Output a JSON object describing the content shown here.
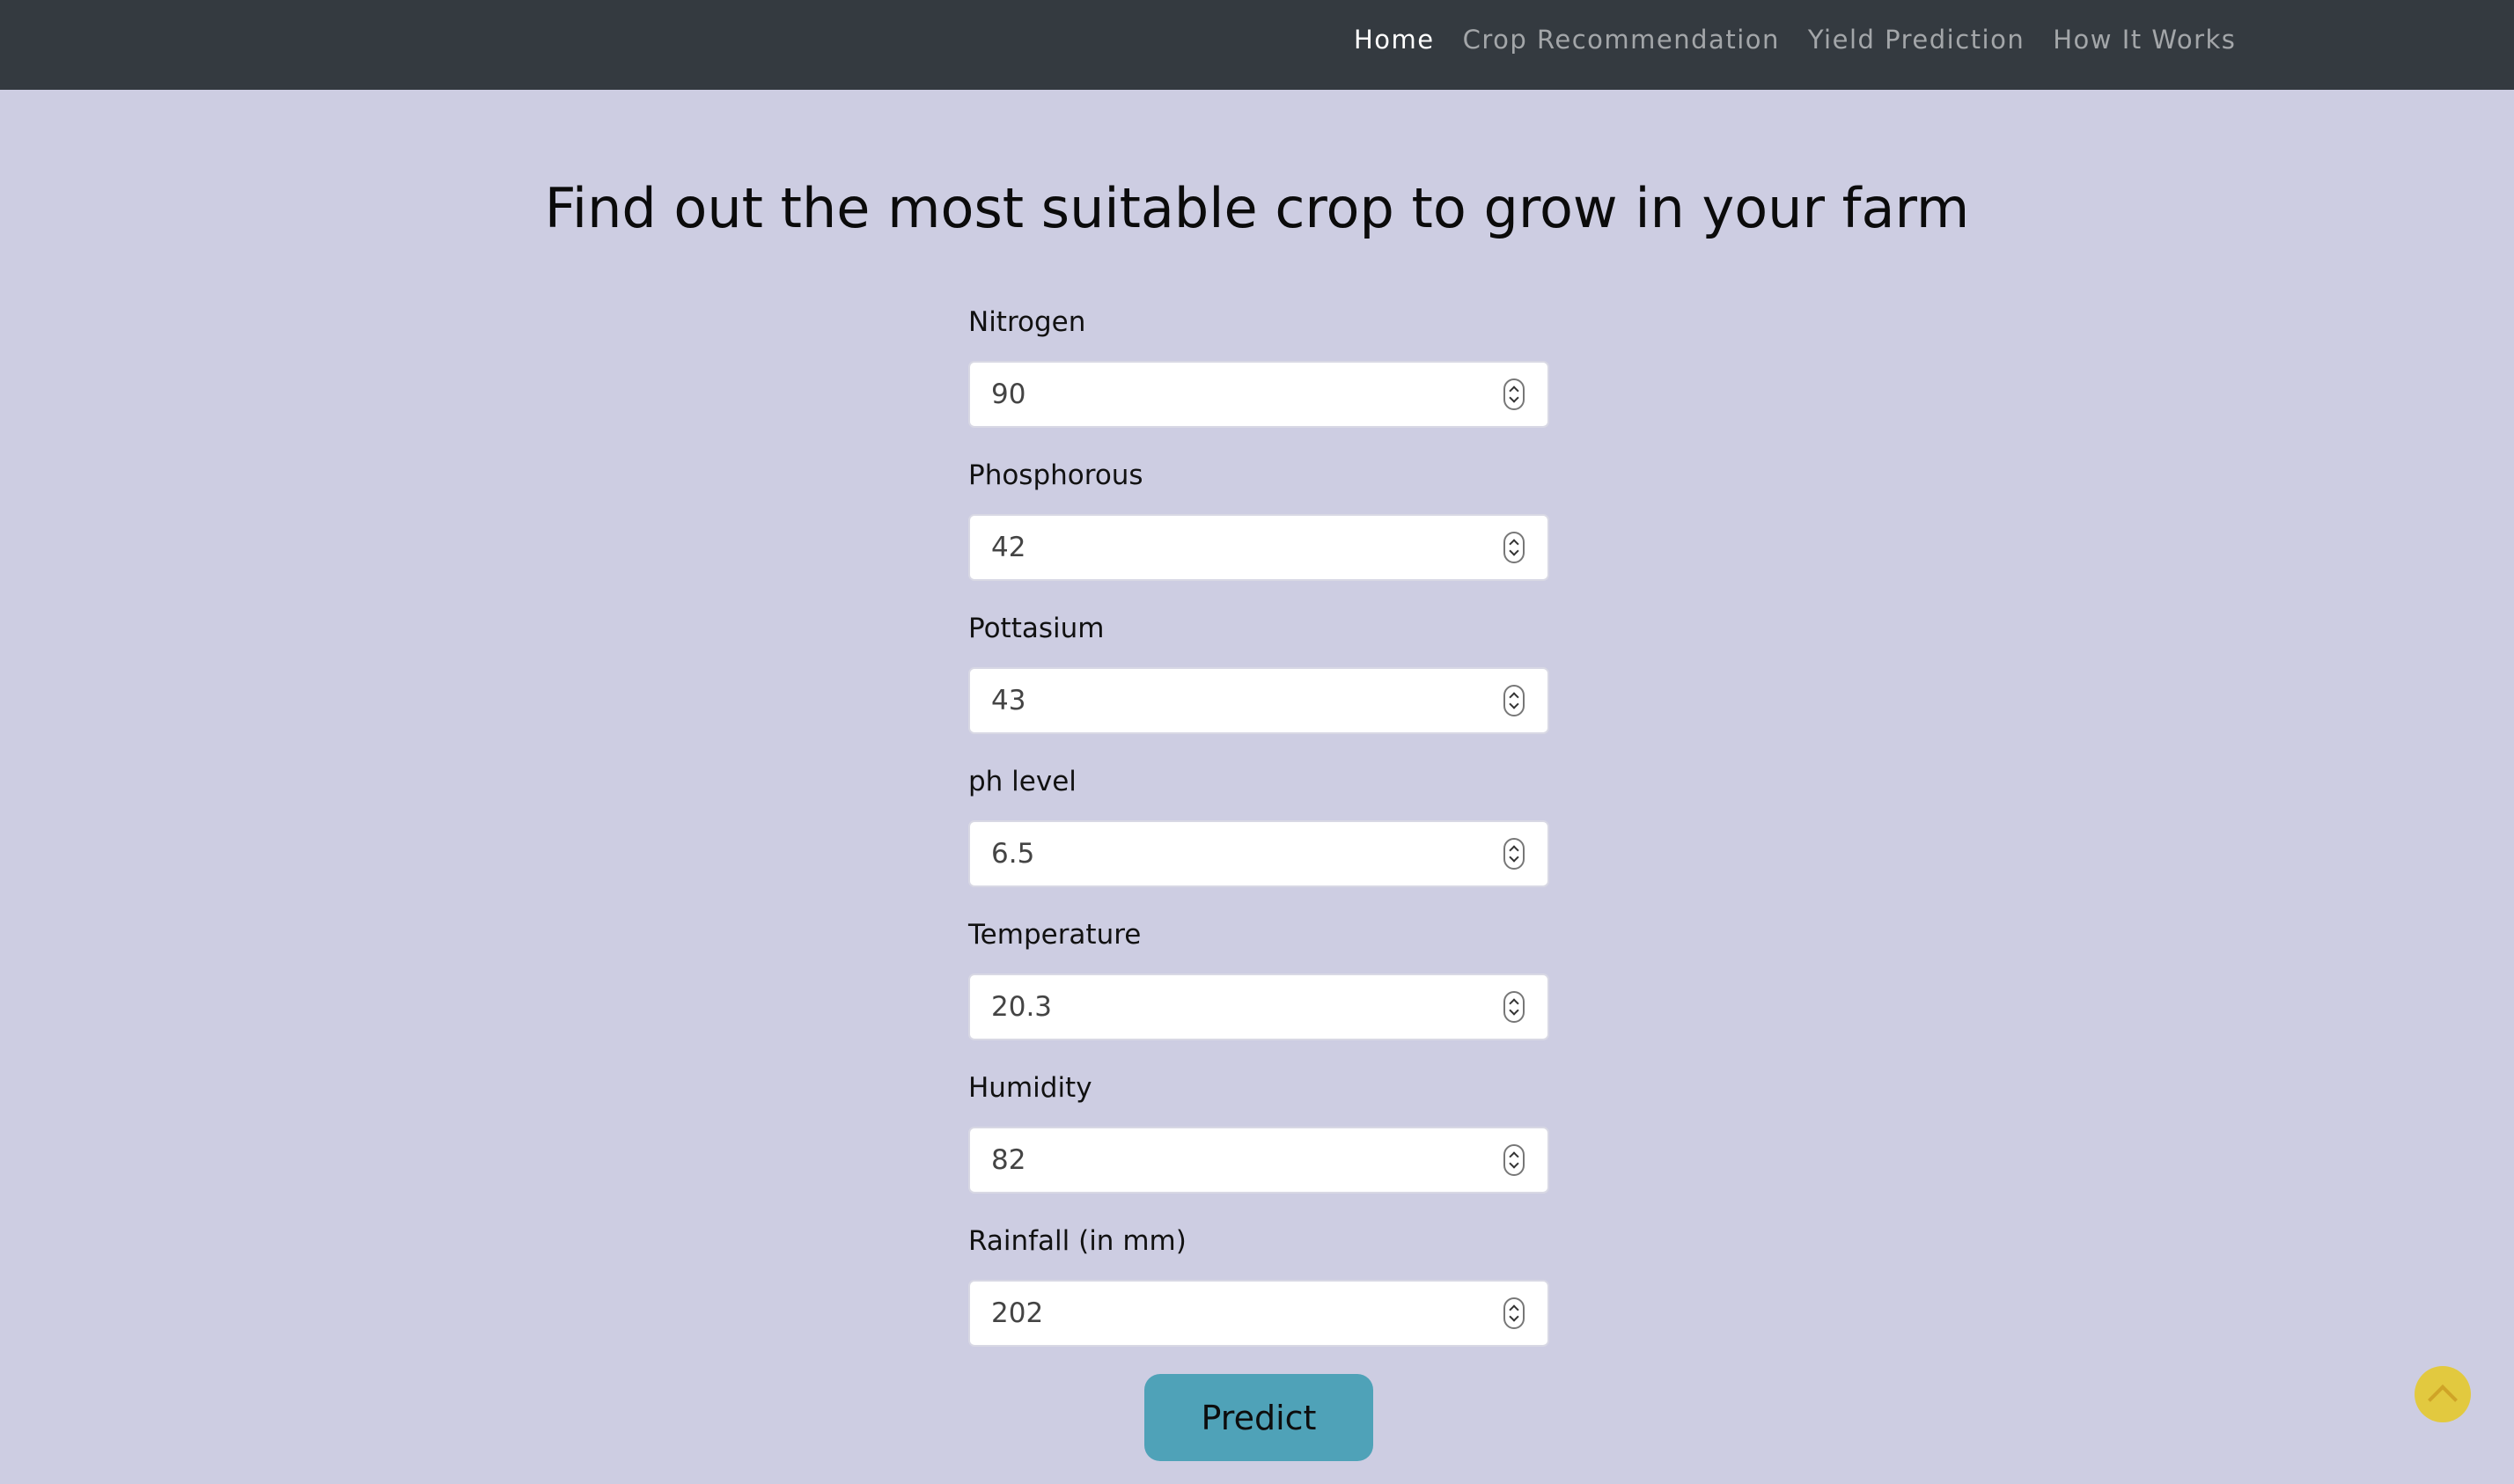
{
  "nav": {
    "links": [
      {
        "label": "Home",
        "active": true
      },
      {
        "label": "Crop Recommendation",
        "active": false
      },
      {
        "label": "Yield Prediction",
        "active": false
      },
      {
        "label": "How It Works",
        "active": false
      }
    ]
  },
  "page": {
    "title": "Find out the most suitable crop to grow in your farm"
  },
  "form": {
    "fields": [
      {
        "label": "Nitrogen",
        "value": "90"
      },
      {
        "label": "Phosphorous",
        "value": "42"
      },
      {
        "label": "Pottasium",
        "value": "43"
      },
      {
        "label": "ph level",
        "value": "6.5"
      },
      {
        "label": "Temperature",
        "value": "20.3"
      },
      {
        "label": "Humidity",
        "value": "82"
      },
      {
        "label": "Rainfall (in mm)",
        "value": "202"
      }
    ],
    "submit_label": "Predict"
  },
  "colors": {
    "background": "#cdcde2",
    "navbar": "#343a40",
    "predict_button": "#4fa2b8",
    "scroll_top_button": "#e2c93f"
  },
  "icons": {
    "scroll_top": "chevron-up-icon"
  }
}
